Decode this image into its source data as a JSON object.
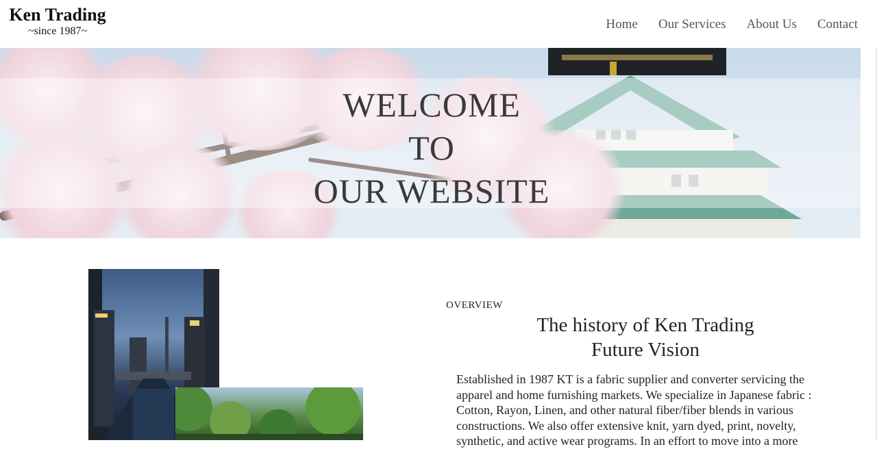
{
  "header": {
    "brand_title": "Ken Trading",
    "brand_subtitle": "~since 1987~"
  },
  "nav": {
    "items": [
      {
        "label": "Home"
      },
      {
        "label": "Our Services"
      },
      {
        "label": "About Us"
      },
      {
        "label": "Contact"
      }
    ]
  },
  "hero": {
    "lines": [
      "WELCOME",
      "TO",
      "OUR WEBSITE"
    ]
  },
  "content": {
    "section_label": "OVERVIEW",
    "heading_line1": "The history of Ken Trading",
    "heading_line2": "Future Vision",
    "description": "Established in 1987 KT is a fabric supplier and converter servicing the apparel and home furnishing markets. We specialize in Japanese fabric : Cotton, Rayon, Linen, and other natural fiber/fiber blends in various constructions. We also offer extensive knit, yarn dyed, print, novelty, synthetic, and active wear programs. In an effort to move into a more"
  }
}
